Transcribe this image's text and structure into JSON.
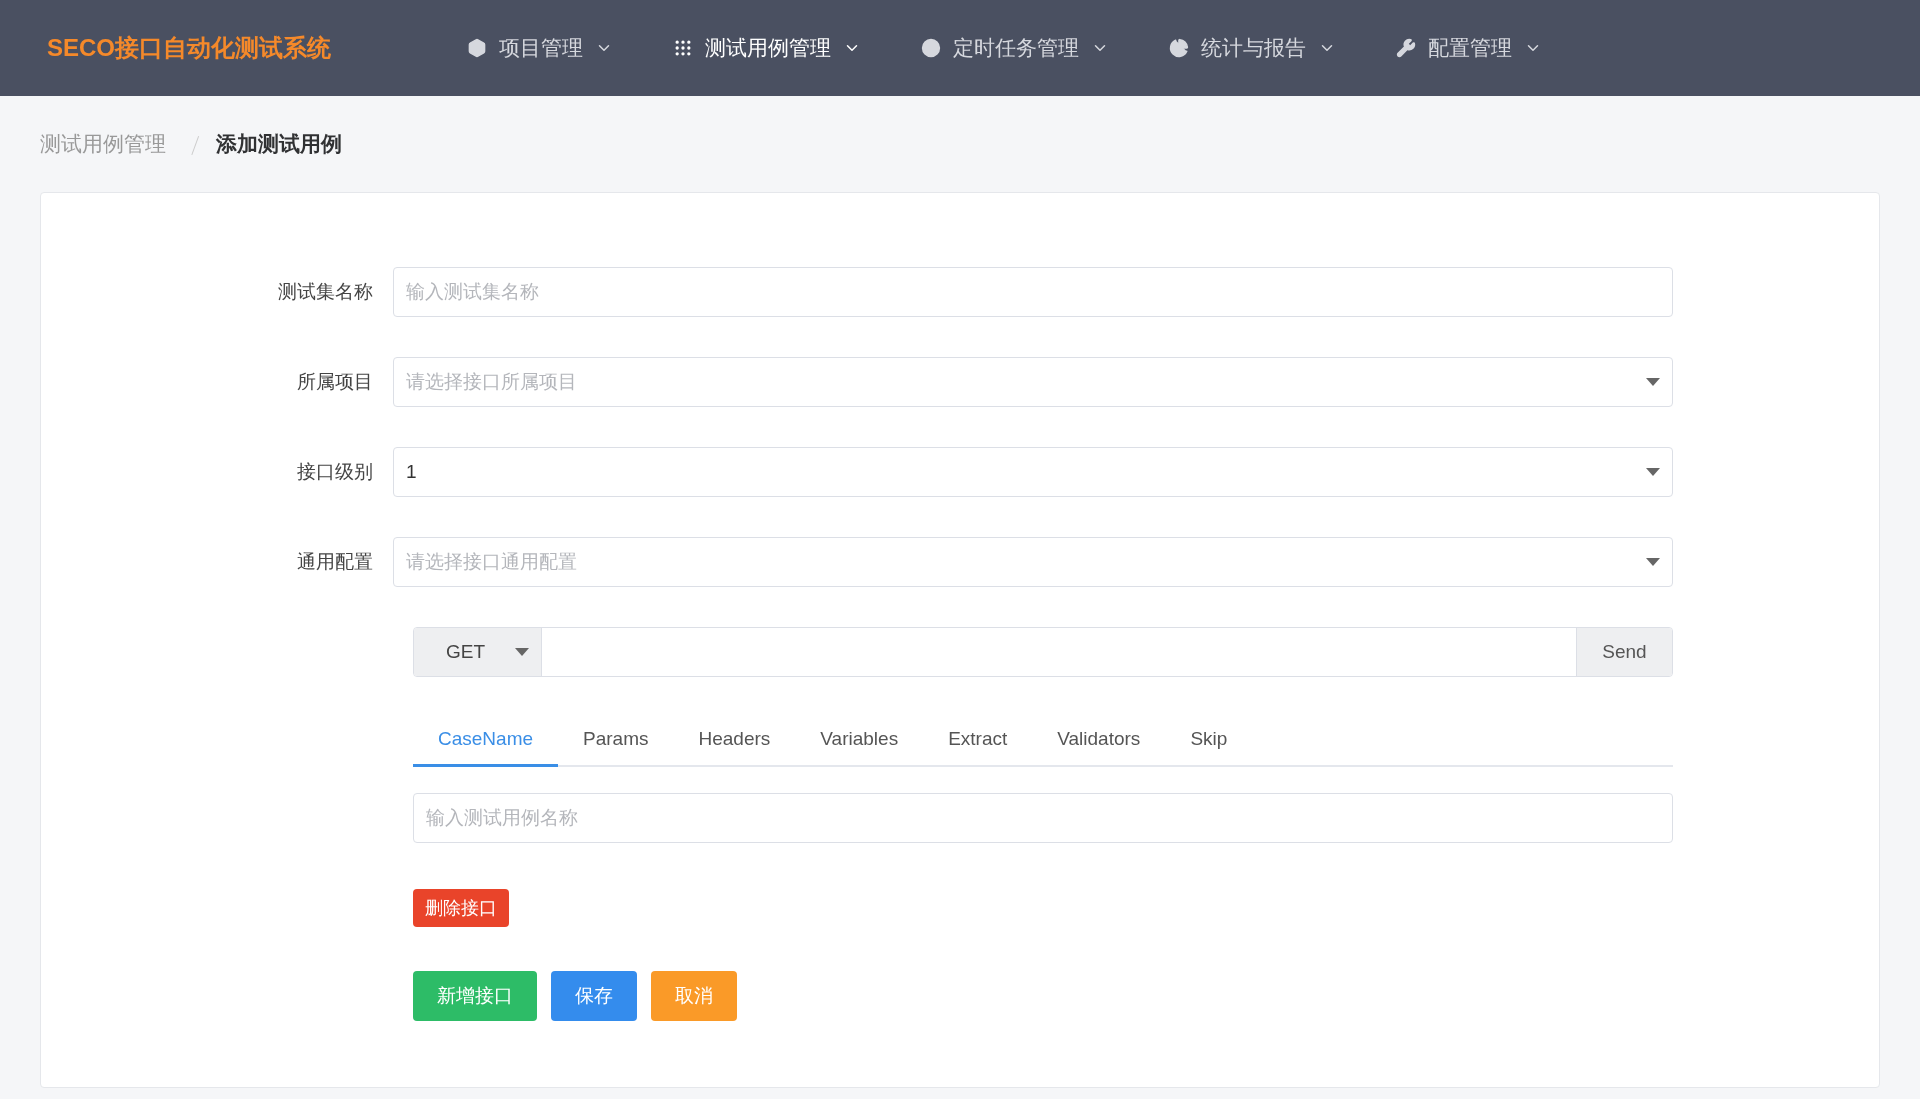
{
  "header": {
    "logo": "SECO接口自动化测试系统",
    "nav": [
      {
        "label": "项目管理",
        "selected": false
      },
      {
        "label": "测试用例管理",
        "selected": true
      },
      {
        "label": "定时任务管理",
        "selected": false
      },
      {
        "label": "统计与报告",
        "selected": false
      },
      {
        "label": "配置管理",
        "selected": false
      }
    ]
  },
  "breadcrumb": [
    {
      "label": "测试用例管理",
      "selected": false
    },
    {
      "label": "添加测试用例",
      "selected": true
    }
  ],
  "form": {
    "fields": [
      {
        "label": "测试集名称",
        "kind": "text",
        "placeholder": "输入测试集名称"
      },
      {
        "label": "所属项目",
        "kind": "select",
        "placeholder": "请选择接口所属项目"
      },
      {
        "label": "接口级别",
        "kind": "select",
        "value": "1"
      },
      {
        "label": "通用配置",
        "kind": "select",
        "placeholder": "请选择接口通用配置"
      }
    ],
    "request": {
      "method": "GET",
      "send": "Send"
    },
    "tabs": [
      {
        "label": "CaseName",
        "selected": true
      },
      {
        "label": "Params",
        "selected": false
      },
      {
        "label": "Headers",
        "selected": false
      },
      {
        "label": "Variables",
        "selected": false
      },
      {
        "label": "Extract",
        "selected": false
      },
      {
        "label": "Validators",
        "selected": false
      },
      {
        "label": "Skip",
        "selected": false
      }
    ],
    "case_name": {
      "placeholder": "输入测试用例名称"
    },
    "delete_button": "删除接口",
    "buttons": [
      {
        "label": "新增接口",
        "kind": "success"
      },
      {
        "label": "保存",
        "kind": "primary"
      },
      {
        "label": "取消",
        "kind": "warning"
      }
    ]
  }
}
